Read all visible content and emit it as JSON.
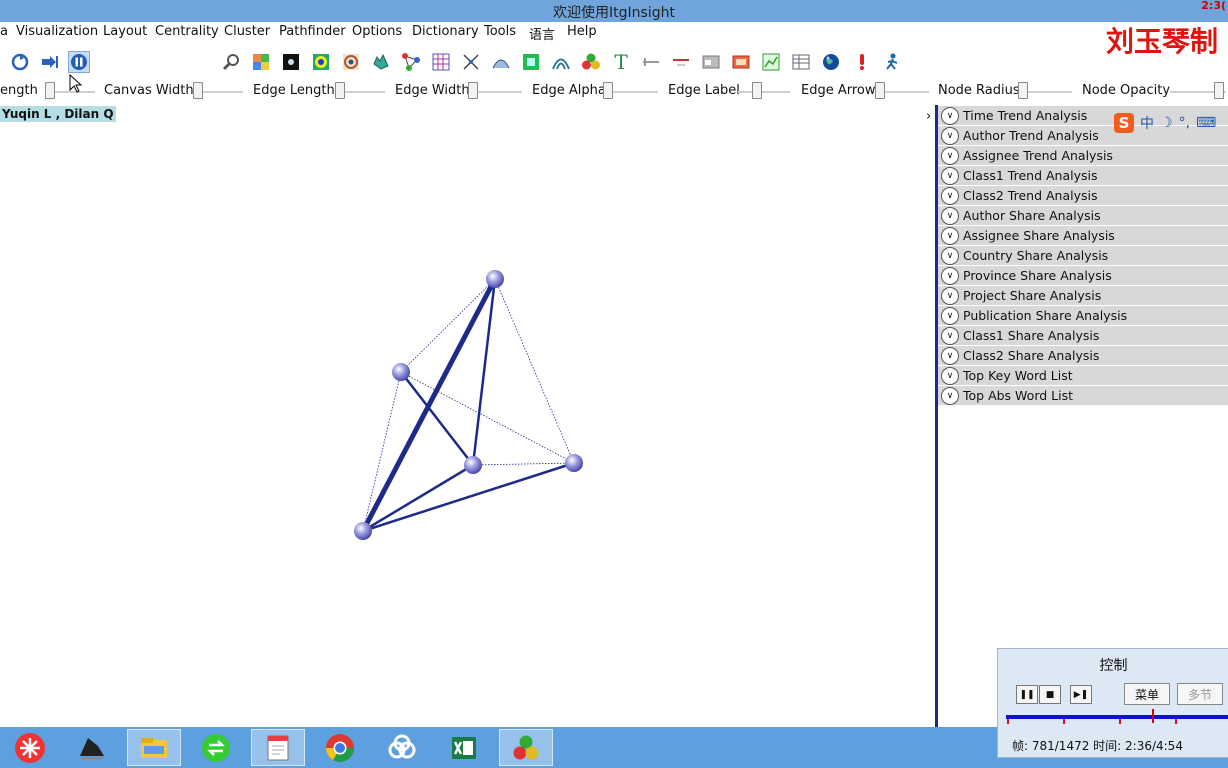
{
  "window": {
    "title": "欢迎使用ItgInsight",
    "clock": "2:3("
  },
  "watermark": "刘玉琴制",
  "menu": [
    "a",
    "Visualization",
    "Layout",
    "Centrality",
    "Cluster",
    "Pathfinder",
    "Options",
    "Dictionary",
    "Tools",
    "语言",
    "Help"
  ],
  "toolbar": {
    "search_value": "",
    "icons": [
      "recycle-icon",
      "step-forward-icon",
      "pause-icon",
      "search-icon",
      "color-grid-icon",
      "black-square-icon",
      "target-icon",
      "ring-icon",
      "map-icon",
      "network-icon",
      "matrix-icon",
      "scissors-icon",
      "curve-icon",
      "green-square-icon",
      "arc-icon",
      "balls-icon",
      "text-icon",
      "pin-icon",
      "line-icon",
      "window-icon",
      "photo-icon",
      "chart-icon",
      "table-icon",
      "globe-icon",
      "bulb-icon",
      "walker-icon"
    ]
  },
  "controls": [
    "ength",
    "Canvas Width",
    "Edge Length",
    "Edge Width",
    "Edge Alpha",
    "Edge Label",
    "Edge Arrow",
    "Node Radius",
    "Node Opacity"
  ],
  "node_label": "Yuqin L , Dilan Q",
  "panel": {
    "items": [
      "Time Trend Analysis",
      "Author Trend Analysis",
      "Assignee Trend Analysis",
      "Class1 Trend Analysis",
      "Class2 Trend Analysis",
      "Author Share Analysis",
      "Assignee Share Analysis",
      "Country Share Analysis",
      "Province Share Analysis",
      "Project Share Analysis",
      "Publication Share Analysis",
      "Class1 Share Analysis",
      "Class2 Share Analysis",
      "Top Key Word List",
      "Top Abs Word List"
    ],
    "collapse_glyph": "›"
  },
  "ime": {
    "logo": "S",
    "mode": "中",
    "moon": "☽",
    "punct": "°,",
    "keyboard": "⌨"
  },
  "control_panel": {
    "title": "控制",
    "menu_button": "菜单",
    "multi_button": "多节",
    "frame_info": "帧: 781/1472 时间: 2:36/4:54",
    "progress": 0.53
  },
  "taskbar": [
    "app-launcher-icon",
    "dock-icon",
    "file-explorer-icon",
    "sync-icon",
    "notepad-icon",
    "chrome-icon",
    "baidu-cloud-icon",
    "excel-icon",
    "itginsight-icon"
  ],
  "colors": {
    "titlebar": "#6fa5dc",
    "taskbar": "#5ca0df",
    "edge": "#1e2a8a",
    "node": "#6f70c8",
    "watermark": "#e0140e"
  }
}
